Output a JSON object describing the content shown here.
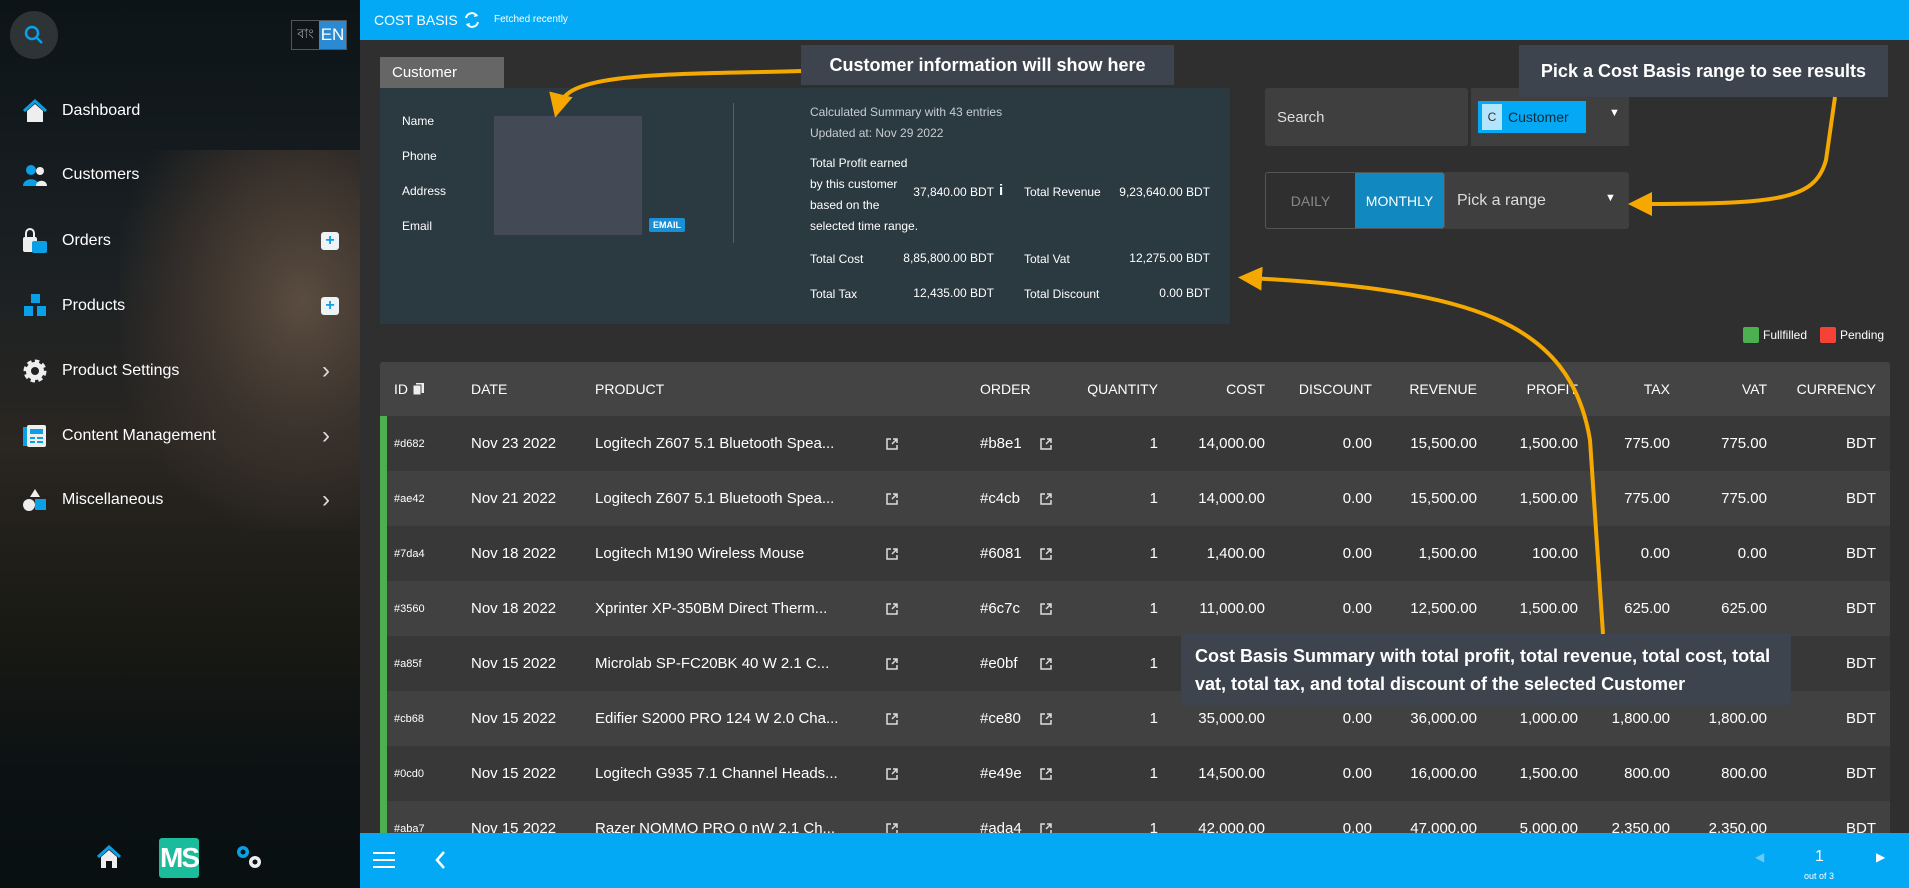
{
  "sidebar": {
    "lang": {
      "bn": "বাং",
      "en": "EN"
    },
    "items": [
      {
        "label": "Dashboard",
        "icon": "home-icon"
      },
      {
        "label": "Customers",
        "icon": "users-icon"
      },
      {
        "label": "Orders",
        "icon": "shopping-bag-icon",
        "action": "plus"
      },
      {
        "label": "Products",
        "icon": "boxes-icon",
        "action": "plus"
      },
      {
        "label": "Product Settings",
        "icon": "gear-icon",
        "action": "chevron"
      },
      {
        "label": "Content Management",
        "icon": "content-icon",
        "action": "chevron"
      },
      {
        "label": "Miscellaneous",
        "icon": "shapes-icon",
        "action": "chevron"
      }
    ],
    "logo": "MS"
  },
  "topbar": {
    "title": "COST BASIS",
    "status": "Fetched recently"
  },
  "customer": {
    "tab": "Customer",
    "fields": [
      "Name",
      "Phone",
      "Address",
      "Email"
    ],
    "email_badge": "EMAIL"
  },
  "summary": {
    "entries": "Calculated Summary with 43 entries",
    "updated": "Updated at: Nov 29 2022",
    "profit_label": [
      "Total Profit earned",
      "by this customer",
      "based on the",
      "selected time range."
    ],
    "profit_value": "37,840.00 BDT",
    "revenue_label": "Total Revenue",
    "revenue_value": "9,23,640.00 BDT",
    "cost_label": "Total Cost",
    "cost_value": "8,85,800.00 BDT",
    "vat_label": "Total Vat",
    "vat_value": "12,275.00 BDT",
    "tax_label": "Total Tax",
    "tax_value": "12,435.00 BDT",
    "discount_label": "Total Discount",
    "discount_value": "0.00 BDT"
  },
  "filters": {
    "search_placeholder": "Search",
    "chip_letter": "C",
    "chip_label": "Customer",
    "daily": "DAILY",
    "monthly": "MONTHLY",
    "active": "MONTHLY",
    "range_placeholder": "Pick a range"
  },
  "legend": [
    {
      "label": "Fullfilled",
      "color": "#4caf50"
    },
    {
      "label": "Pending",
      "color": "#f44336"
    }
  ],
  "callouts": {
    "customer": "Customer information will show here",
    "range": "Pick a Cost Basis range to see results",
    "summary": "Cost Basis Summary with total profit, total revenue, total cost, total vat, total tax, and total discount of the selected Customer"
  },
  "table": {
    "headers": [
      "ID",
      "DATE",
      "PRODUCT",
      "ORDER",
      "QUANTITY",
      "COST",
      "DISCOUNT",
      "REVENUE",
      "PROFIT",
      "TAX",
      "VAT",
      "CURRENCY"
    ],
    "rows": [
      [
        "#d682",
        "Nov 23 2022",
        "Logitech Z607 5.1 Bluetooth Spea...",
        "#b8e1",
        "1",
        "14,000.00",
        "0.00",
        "15,500.00",
        "1,500.00",
        "775.00",
        "775.00",
        "BDT"
      ],
      [
        "#ae42",
        "Nov 21 2022",
        "Logitech Z607 5.1 Bluetooth Spea...",
        "#c4cb",
        "1",
        "14,000.00",
        "0.00",
        "15,500.00",
        "1,500.00",
        "775.00",
        "775.00",
        "BDT"
      ],
      [
        "#7da4",
        "Nov 18 2022",
        "Logitech M190 Wireless Mouse",
        "#6081",
        "1",
        "1,400.00",
        "0.00",
        "1,500.00",
        "100.00",
        "0.00",
        "0.00",
        "BDT"
      ],
      [
        "#3560",
        "Nov 18 2022",
        "Xprinter XP-350BM Direct Therm...",
        "#6c7c",
        "1",
        "11,000.00",
        "0.00",
        "12,500.00",
        "1,500.00",
        "625.00",
        "625.00",
        "BDT"
      ],
      [
        "#a85f",
        "Nov 15 2022",
        "Microlab SP-FC20BK 40 W 2.1 C...",
        "#e0bf",
        "1",
        "",
        "",
        "",
        "",
        "",
        "",
        "BDT"
      ],
      [
        "#cb68",
        "Nov 15 2022",
        "Edifier S2000 PRO 124 W 2.0 Cha...",
        "#ce80",
        "1",
        "35,000.00",
        "0.00",
        "36,000.00",
        "1,000.00",
        "1,800.00",
        "1,800.00",
        "BDT"
      ],
      [
        "#0cd0",
        "Nov 15 2022",
        "Logitech G935 7.1 Channel Heads...",
        "#e49e",
        "1",
        "14,500.00",
        "0.00",
        "16,000.00",
        "1,500.00",
        "800.00",
        "800.00",
        "BDT"
      ],
      [
        "#aba7",
        "Nov 15 2022",
        "Razer NOMMO PRO 0 nW 2.1 Ch...",
        "#ada4",
        "1",
        "42,000.00",
        "0.00",
        "47,000.00",
        "5,000.00",
        "2,350.00",
        "2,350.00",
        "BDT"
      ]
    ],
    "status": [
      "fulfilled",
      "fulfilled",
      "fulfilled",
      "fulfilled",
      "fulfilled",
      "fulfilled",
      "fulfilled",
      "fulfilled"
    ]
  },
  "pagination": {
    "page": "1",
    "total": "out of 3"
  },
  "colors": {
    "accent": "#03a9f4",
    "arrow": "#f5a800",
    "panel": "#2b3941",
    "callout": "#3e444e"
  }
}
